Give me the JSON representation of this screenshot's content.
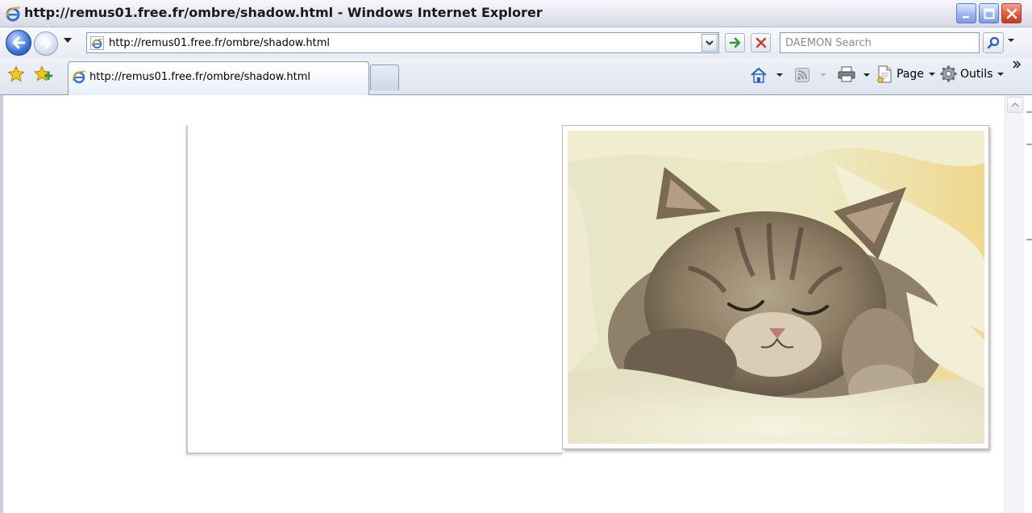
{
  "window": {
    "title": "http://remus01.free.fr/ombre/shadow.html - Windows Internet Explorer"
  },
  "navigation": {
    "address": "http://remus01.free.fr/ombre/shadow.html",
    "search_placeholder": "DAEMON Search"
  },
  "tabs": [
    {
      "label": "http://remus01.free.fr/ombre/shadow.html",
      "active": true
    }
  ],
  "toolbar": {
    "page_label": "Page",
    "tools_label": "Outils"
  },
  "icons": {
    "browser": "ie-logo-icon",
    "back": "back-arrow-icon",
    "forward": "forward-arrow-icon",
    "go": "go-arrow-icon",
    "stop": "stop-x-icon",
    "search": "magnifier-icon",
    "favorites": "favorites-star-icon",
    "add_favorites": "add-favorites-icon",
    "home": "home-icon",
    "feeds": "rss-feed-icon",
    "print": "printer-icon",
    "page": "page-icon",
    "tools": "gear-icon",
    "overflow": "chevron-double-right-icon"
  },
  "colors": {
    "titlebar": "#e4e6ef",
    "accent_blue": "#3a72d8",
    "close_red": "#df5a3c",
    "go_green": "#2e9a2e"
  },
  "content": {
    "image": "sleeping-kitten-photo"
  }
}
